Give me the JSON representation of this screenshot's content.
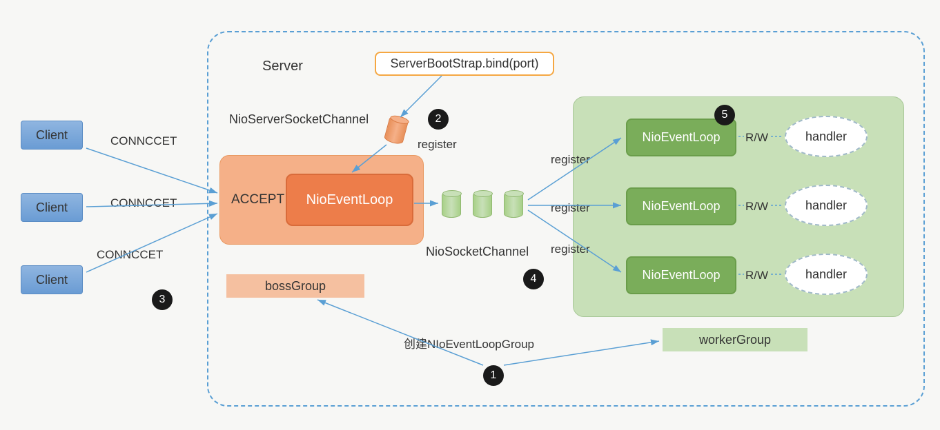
{
  "server": {
    "label": "Server",
    "bootstrap": "ServerBootStrap.bind(port)",
    "nio_server_socket_channel": "NioServerSocketChannel",
    "register": "register",
    "nio_socket_channel": "NioSocketChannel"
  },
  "clients": {
    "label": "Client",
    "connect": "CONNCCET"
  },
  "boss": {
    "accept": "ACCEPT",
    "nioeventloop": "NioEventLoop",
    "bossgroup": "bossGroup"
  },
  "worker": {
    "nioeventloop": "NioEventLoop",
    "rw": "R/W",
    "handler": "handler",
    "register": "register",
    "workergroup": "workerGroup"
  },
  "create_label": "创建NIoEventLoopGroup",
  "steps": {
    "s1": "1",
    "s2": "2",
    "s3": "3",
    "s4": "4",
    "s5": "5"
  }
}
